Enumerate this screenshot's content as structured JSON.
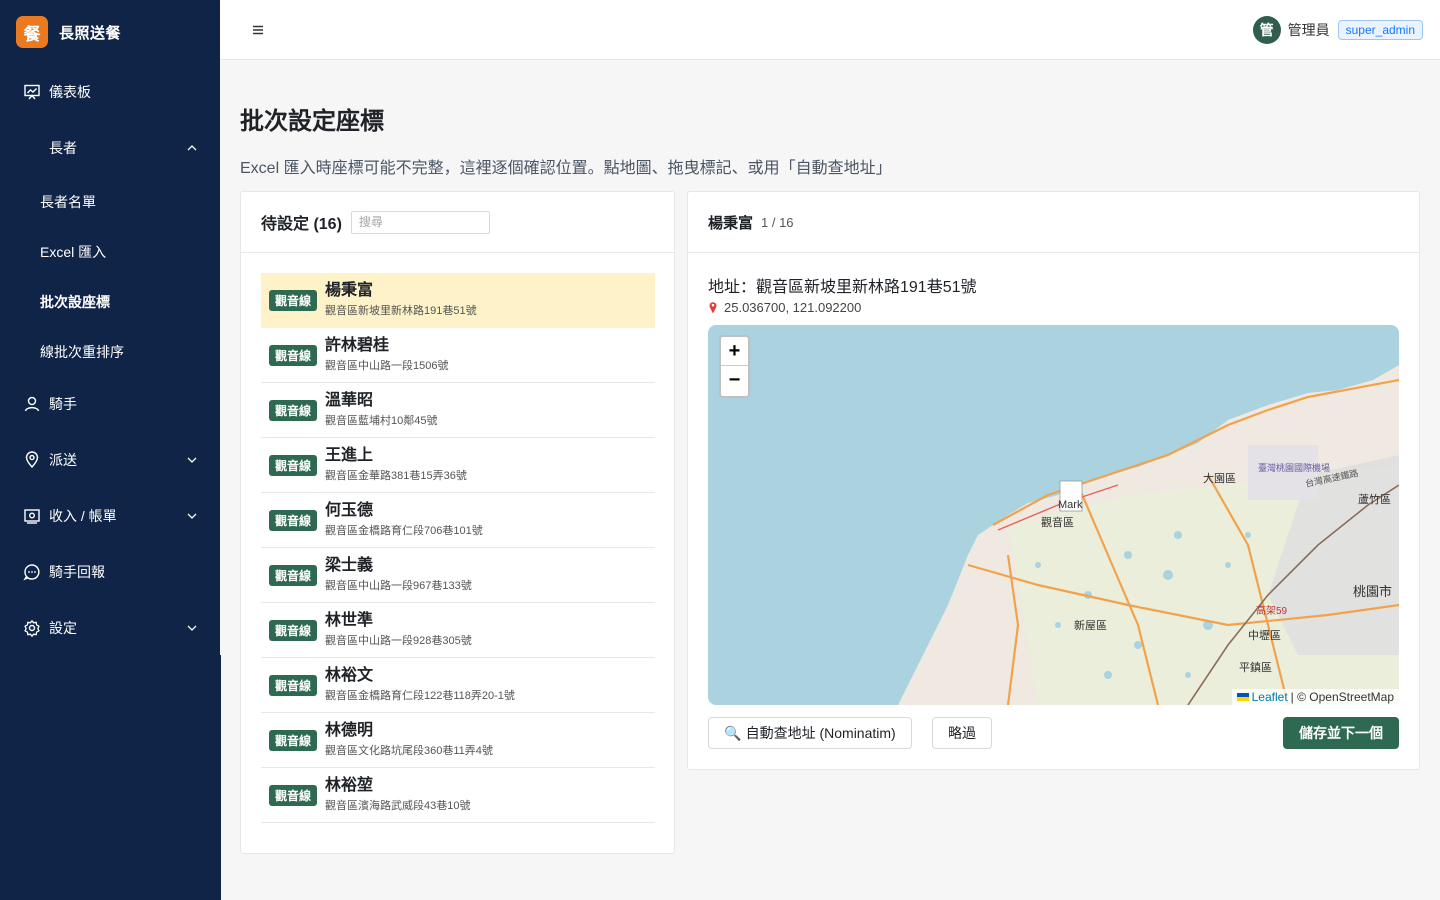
{
  "brand": {
    "logo_char": "餐",
    "name": "長照送餐"
  },
  "sidebar": {
    "items": [
      {
        "label": "儀表板",
        "icon": "dashboard-icon"
      },
      {
        "label": "長者"
      },
      {
        "label": "長者名單"
      },
      {
        "label": "Excel 匯入"
      },
      {
        "label": "批次設座標",
        "active": true
      },
      {
        "label": "線批次重排序"
      },
      {
        "label": "騎手",
        "icon": "user-icon"
      },
      {
        "label": "派送",
        "icon": "location-icon"
      },
      {
        "label": "收入 / 帳單",
        "icon": "billing-icon"
      },
      {
        "label": "騎手回報",
        "icon": "message-icon"
      },
      {
        "label": "設定",
        "icon": "gear-icon"
      }
    ]
  },
  "header": {
    "avatar_char": "管",
    "user_name": "管理員",
    "role": "super_admin"
  },
  "page": {
    "title": "批次設定座標",
    "description": "Excel 匯入時座標可能不完整，這裡逐個確認位置。點地圖、拖曳標記、或用「自動查地址」"
  },
  "pending": {
    "title": "待設定 (16)",
    "search_placeholder": "搜尋",
    "items": [
      {
        "tag": "觀音線",
        "name": "楊秉富",
        "address": "觀音區新坡里新林路191巷51號",
        "selected": true
      },
      {
        "tag": "觀音線",
        "name": "許林碧桂",
        "address": "觀音區中山路一段1506號"
      },
      {
        "tag": "觀音線",
        "name": "溫華昭",
        "address": "觀音區藍埔村10鄰45號"
      },
      {
        "tag": "觀音線",
        "name": "王進上",
        "address": "觀音區金華路381巷15弄36號"
      },
      {
        "tag": "觀音線",
        "name": "何玉德",
        "address": "觀音區金橋路育仁段706巷101號"
      },
      {
        "tag": "觀音線",
        "name": "梁士義",
        "address": "觀音區中山路一段967巷133號"
      },
      {
        "tag": "觀音線",
        "name": "林世準",
        "address": "觀音區中山路一段928巷305號"
      },
      {
        "tag": "觀音線",
        "name": "林裕文",
        "address": "觀音區金橋路育仁段122巷118弄20-1號"
      },
      {
        "tag": "觀音線",
        "name": "林德明",
        "address": "觀音區文化路坑尾段360巷11弄4號"
      },
      {
        "tag": "觀音線",
        "name": "林裕堃",
        "address": "觀音區濱海路武威段43巷10號"
      }
    ]
  },
  "detail": {
    "name": "楊秉富",
    "count": "1 / 16",
    "address_line": "地址：觀音區新坡里新林路191巷51號",
    "coords": "25.036700, 121.092200",
    "map": {
      "zoom_in": "+",
      "zoom_out": "−",
      "marker_alt": "Mark",
      "attribution_leaflet": "Leaflet",
      "attribution_osm": "| © OpenStreetMap",
      "labels": [
        "大園區",
        "臺灣桃園國際機場",
        "台灣高速鐵路",
        "蘆竹區",
        "觀音區",
        "新屋區",
        "中壢區",
        "平鎮區",
        "桃園市",
        "高架59"
      ],
      "colors": {
        "sea": "#aad3df",
        "land": "#efe9e1",
        "road": "#f2a24b"
      }
    },
    "buttons": {
      "geocode": "🔍 自動查地址 (Nominatim)",
      "skip": "略過",
      "save_next": "儲存並下一個"
    }
  }
}
